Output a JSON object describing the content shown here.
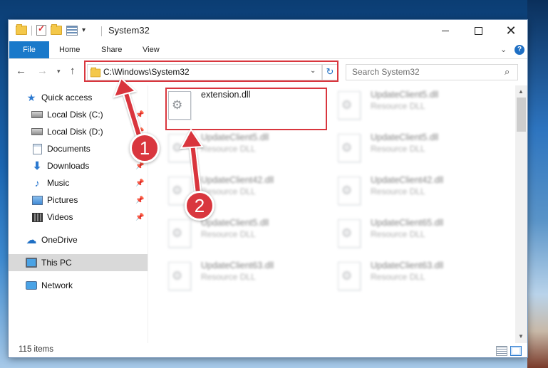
{
  "window": {
    "title": "System32",
    "qat_dropdown": "▾"
  },
  "ribbon": {
    "tabs": [
      "File",
      "Home",
      "Share",
      "View"
    ]
  },
  "nav": {
    "address": "C:\\Windows\\System32",
    "search_placeholder": "Search System32"
  },
  "sidebar": {
    "quick_access": "Quick access",
    "pinned": [
      {
        "label": "Local Disk (C:)",
        "icon": "disk-icon"
      },
      {
        "label": "Local Disk (D:)",
        "icon": "disk-icon"
      },
      {
        "label": "Documents",
        "icon": "documents-icon"
      },
      {
        "label": "Downloads",
        "icon": "downloads-icon"
      },
      {
        "label": "Music",
        "icon": "music-icon"
      },
      {
        "label": "Pictures",
        "icon": "pictures-icon"
      },
      {
        "label": "Videos",
        "icon": "videos-icon"
      }
    ],
    "onedrive": "OneDrive",
    "this_pc": "This PC",
    "network": "Network"
  },
  "files": [
    {
      "name": "extension.dll",
      "type": ""
    },
    {
      "name": "UpdateClient5.dll",
      "type": "Resource DLL"
    },
    {
      "name": "UpdateClient5.dll",
      "type": "Resource DLL"
    },
    {
      "name": "UpdateClient5.dll",
      "type": "Resource DLL"
    },
    {
      "name": "UpdateClient42.dll",
      "type": "Resource DLL"
    },
    {
      "name": "UpdateClient42.dll",
      "type": "Resource DLL"
    },
    {
      "name": "UpdateClient5.dll",
      "type": "Resource DLL"
    },
    {
      "name": "UpdateClient65.dll",
      "type": "Resource DLL"
    },
    {
      "name": "UpdateClient63.dll",
      "type": "Resource DLL"
    },
    {
      "name": "UpdateClient63.dll",
      "type": "Resource DLL"
    }
  ],
  "status": {
    "item_count": "115 items"
  },
  "annotations": {
    "step1": "1",
    "step2": "2",
    "color": "#d9363e"
  }
}
